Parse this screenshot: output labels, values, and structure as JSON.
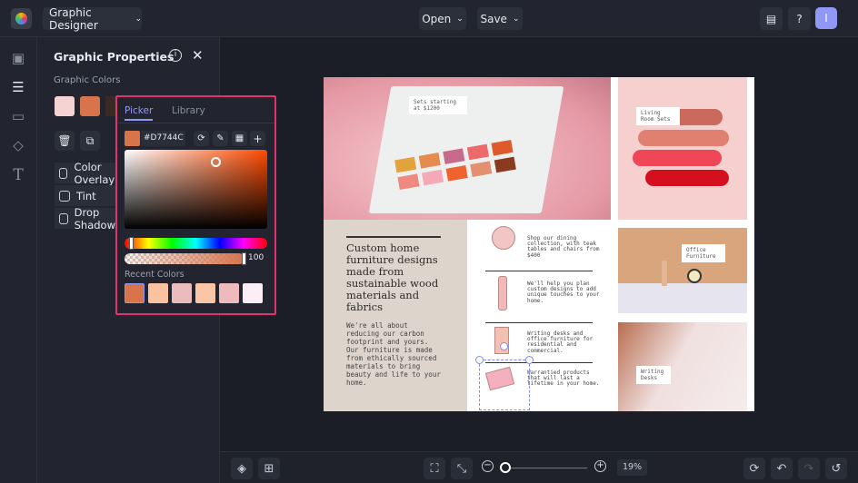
{
  "topbar": {
    "app_menu": "Graphic Designer",
    "open": "Open",
    "save": "Save",
    "avatar": "I"
  },
  "panel": {
    "title": "Graphic Properties",
    "colors_label": "Graphic Colors",
    "swatches": [
      "#f6d3d3",
      "#d7744c",
      "#3a2a26"
    ],
    "checks": [
      "Color Overlay",
      "Tint",
      "Drop Shadow"
    ]
  },
  "picker": {
    "tabs": [
      "Picker",
      "Library"
    ],
    "active_tab": "Picker",
    "hex": "#D7744C",
    "opacity": "100",
    "recent_label": "Recent Colors",
    "recent_colors": [
      "#d7744c",
      "#fbc2a0",
      "#ebbcbc",
      "#fbc6a6",
      "#efbabc",
      "#fbeef4"
    ]
  },
  "design": {
    "tag_sets": "Sets starting at $1200",
    "tag_living": "Living Room Sets",
    "tag_office": "Office Furniture",
    "tag_desks": "Writing Desks",
    "headline": "Custom home furniture designs made from sustainable wood materials and fabrics",
    "body": "We're all about reducing our carbon footprint and yours. Our furniture is made from ethically sourced materials to bring beauty and life to your home.",
    "items": [
      "Shop our dining collection, with teak tables and chairs from $400",
      "We'll help you plan custom designs to add unique touches to your home.",
      "Writing desks and office furniture for residential and commercial.",
      "Warrantied products that will last a lifetime in your home."
    ]
  },
  "bottombar": {
    "zoom": "19%",
    "zoom_level": 0.19
  }
}
